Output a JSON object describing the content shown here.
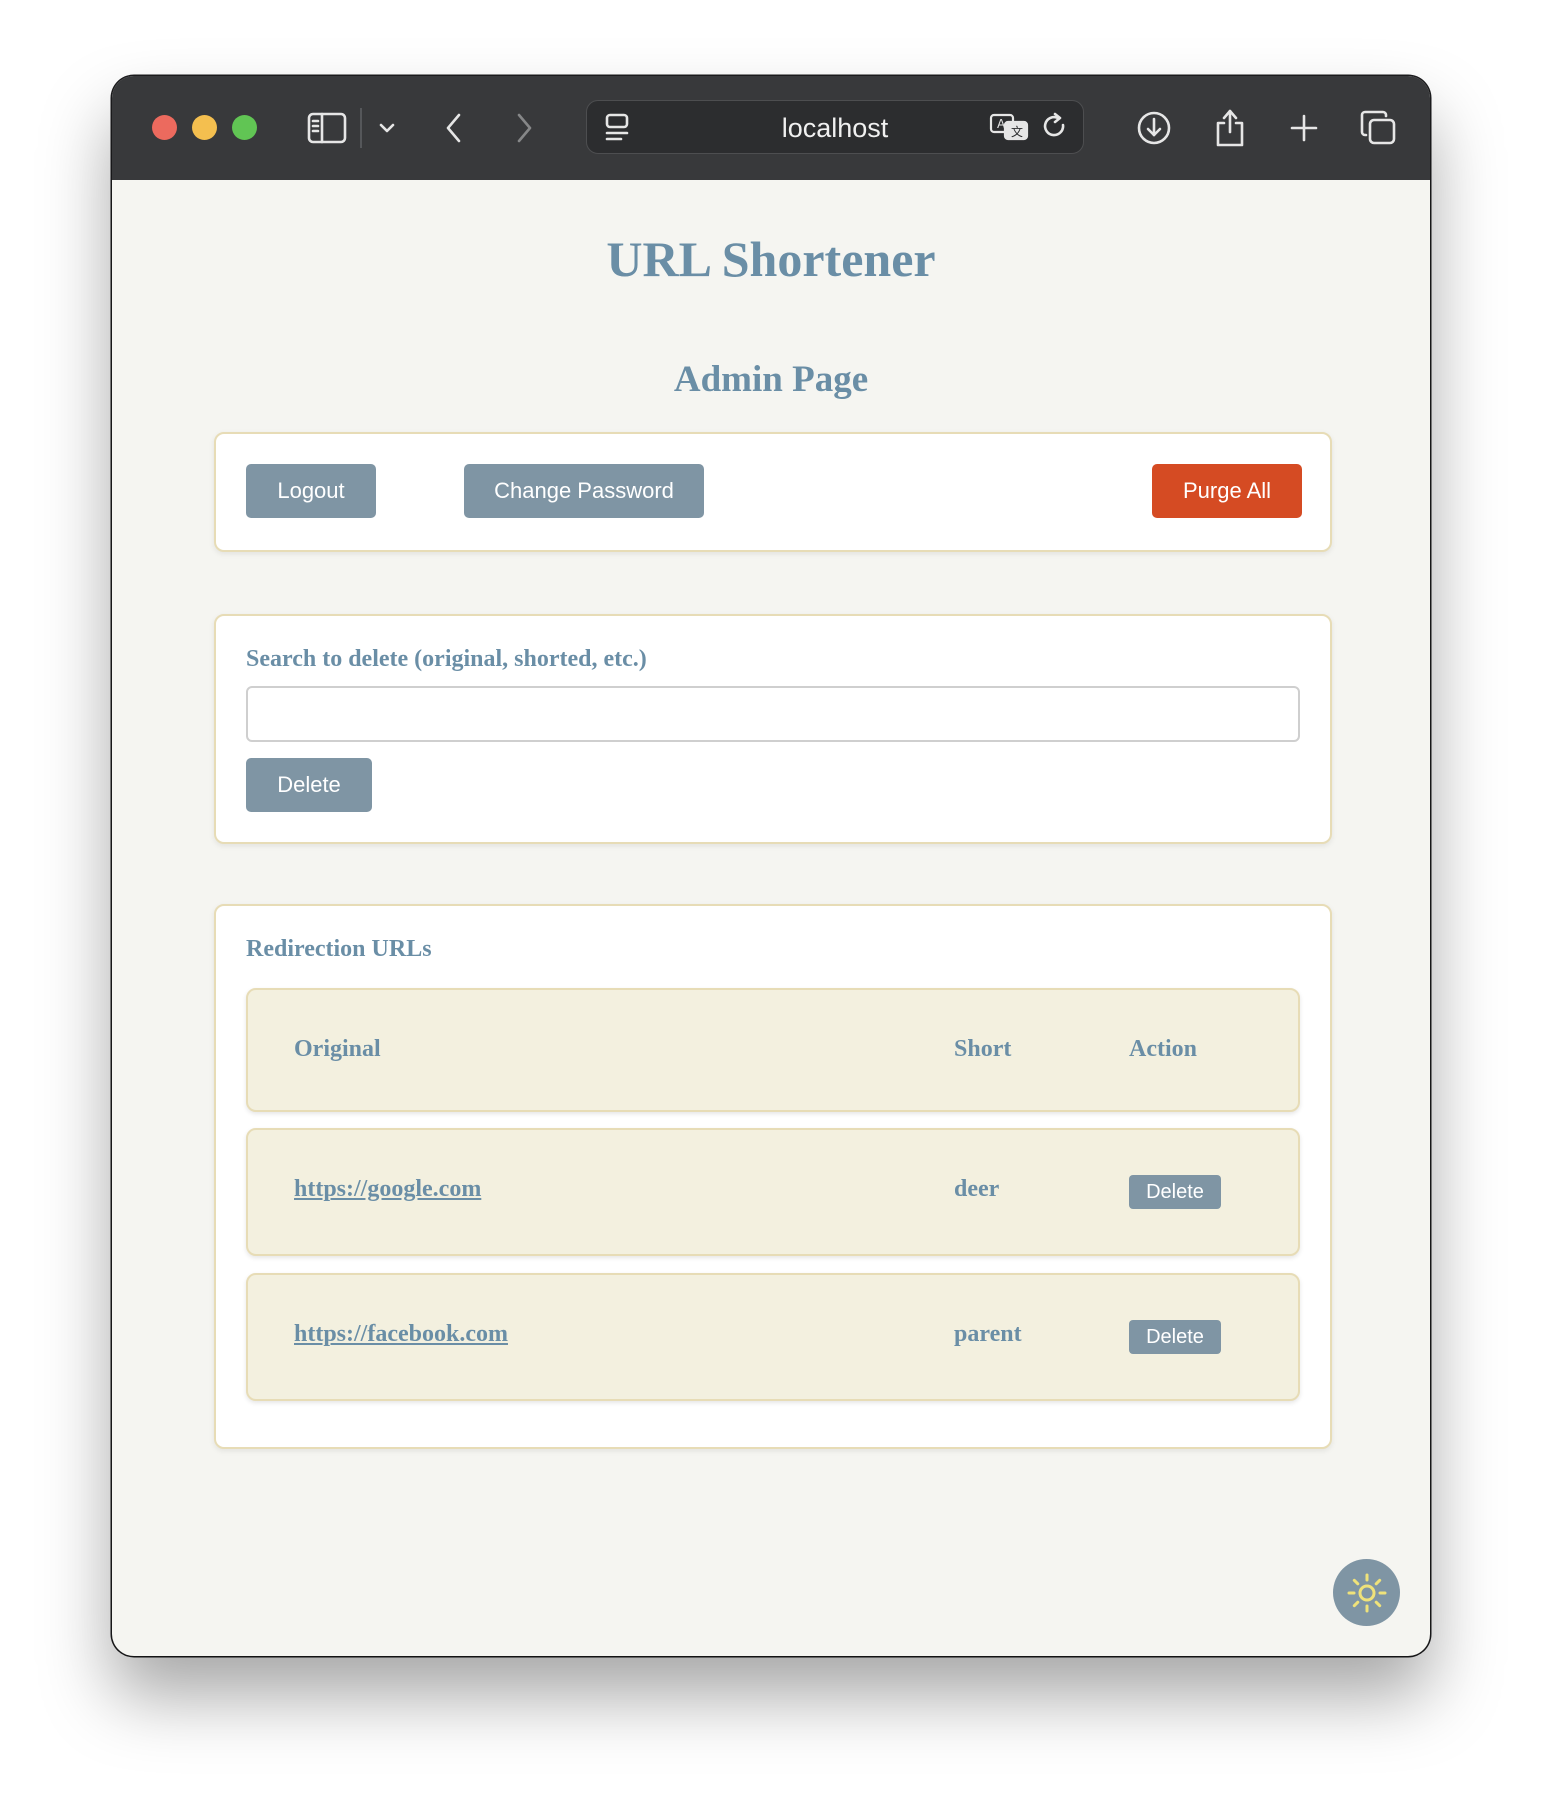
{
  "browser": {
    "url": "localhost",
    "icons": [
      "sidebar-icon",
      "chevron-down-icon",
      "back-icon",
      "forward-icon",
      "reader-icon",
      "translate-icon",
      "reload-icon",
      "download-icon",
      "share-icon",
      "new-tab-icon",
      "tabs-overview-icon"
    ]
  },
  "page": {
    "title": "URL Shortener",
    "subtitle": "Admin Page"
  },
  "toolbar": {
    "logout_label": "Logout",
    "change_password_label": "Change Password",
    "purge_all_label": "Purge All"
  },
  "search": {
    "label": "Search to delete (original, shorted, etc.)",
    "value": "",
    "delete_label": "Delete"
  },
  "redirects": {
    "heading": "Redirection URLs",
    "columns": [
      "Original",
      "Short",
      "Action"
    ],
    "rows": [
      {
        "original": "https://google.com",
        "short": "deer",
        "action": "Delete"
      },
      {
        "original": "https://facebook.com",
        "short": "parent",
        "action": "Delete"
      }
    ]
  },
  "theme_toggle": {
    "icon": "sun-icon"
  },
  "colors": {
    "accent": "#6a8ea6",
    "button_grey": "#7f95a4",
    "danger": "#d54b23",
    "card_border": "#e7dcb6",
    "row_bg": "#f3f0df"
  }
}
